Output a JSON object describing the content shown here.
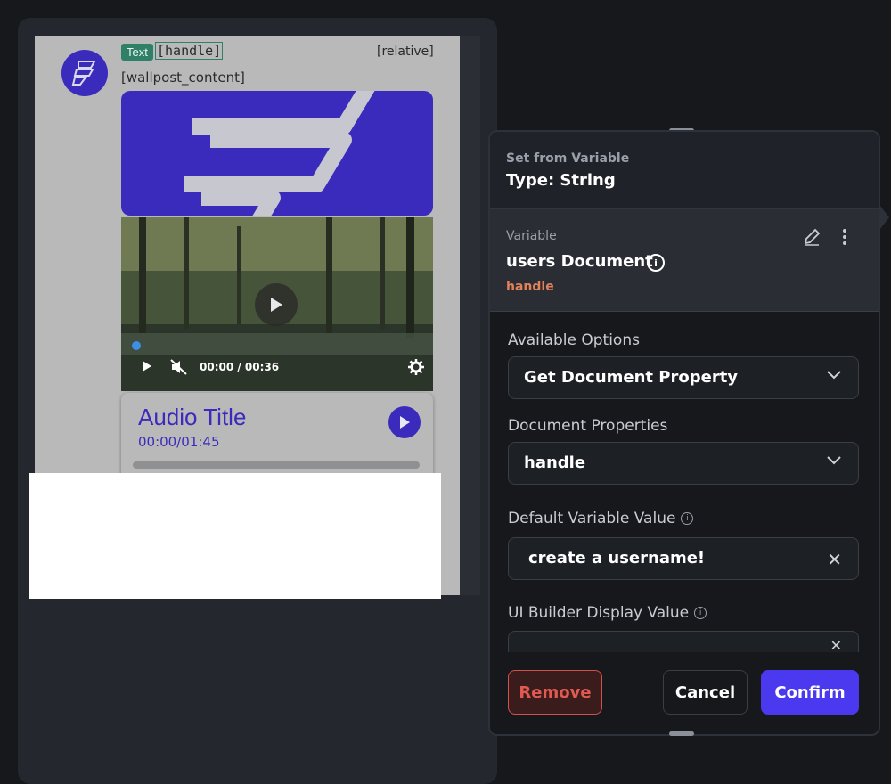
{
  "canvas": {
    "badge_label": "Text",
    "handle_text": "[handle]",
    "relative_text": "[relative]",
    "content_text": "[wallpost_content]",
    "video": {
      "time": "00:00 / 00:36"
    },
    "audio": {
      "title": "Audio Title",
      "time": "00:00/01:45"
    }
  },
  "panel": {
    "header": {
      "subtitle": "Set from Variable",
      "type": "Type: String"
    },
    "variable": {
      "label": "Variable",
      "name": "users Document",
      "property": "handle"
    },
    "fields": {
      "available_options": {
        "label": "Available Options",
        "value": "Get Document Property"
      },
      "document_properties": {
        "label": "Document Properties",
        "value": "handle"
      },
      "default_value": {
        "label": "Default Variable Value",
        "value": "create a username!"
      },
      "ui_builder_value": {
        "label": "UI Builder Display Value",
        "value": ""
      }
    },
    "buttons": {
      "remove": "Remove",
      "cancel": "Cancel",
      "confirm": "Confirm"
    }
  },
  "colors": {
    "brand": "#3b2bbd",
    "accent": "#4b39ef",
    "danger": "#e05a52",
    "property": "#e0815a"
  }
}
